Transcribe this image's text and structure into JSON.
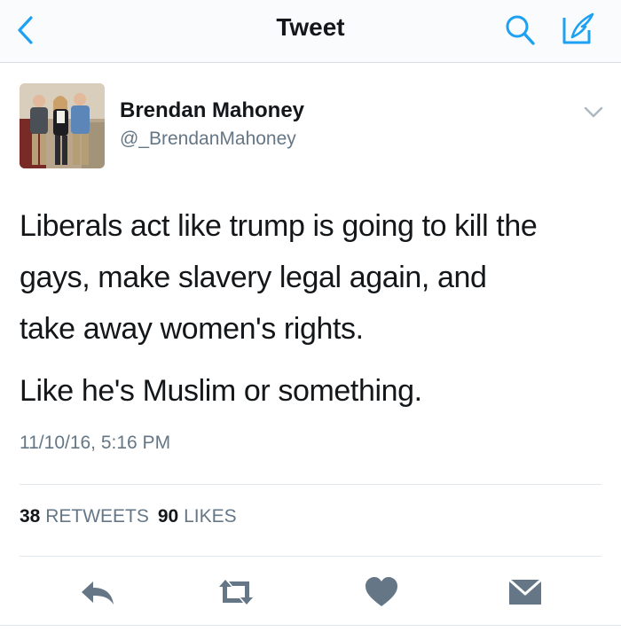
{
  "nav": {
    "title": "Tweet",
    "back_icon": "chevron-left-icon",
    "search_icon": "search-icon",
    "compose_icon": "compose-icon"
  },
  "author": {
    "name": "Brendan Mahoney",
    "handle": "@_BrendanMahoney"
  },
  "tweet": {
    "lines": [
      "Liberals act like trump is going to kill the",
      "gays, make slavery legal again, and",
      "take away women's rights.",
      "Like he's Muslim or something."
    ],
    "timestamp": "11/10/16, 5:16 PM"
  },
  "stats": {
    "retweets_count": "38",
    "retweets_label": "RETWEETS",
    "likes_count": "90",
    "likes_label": "LIKES"
  },
  "actions": [
    "reply-icon",
    "retweet-icon",
    "like-icon",
    "direct-message-icon"
  ],
  "colors": {
    "accent": "#1da1f2",
    "secondary_text": "#657786",
    "primary_text": "#14171a",
    "action_icons": "#657786"
  }
}
